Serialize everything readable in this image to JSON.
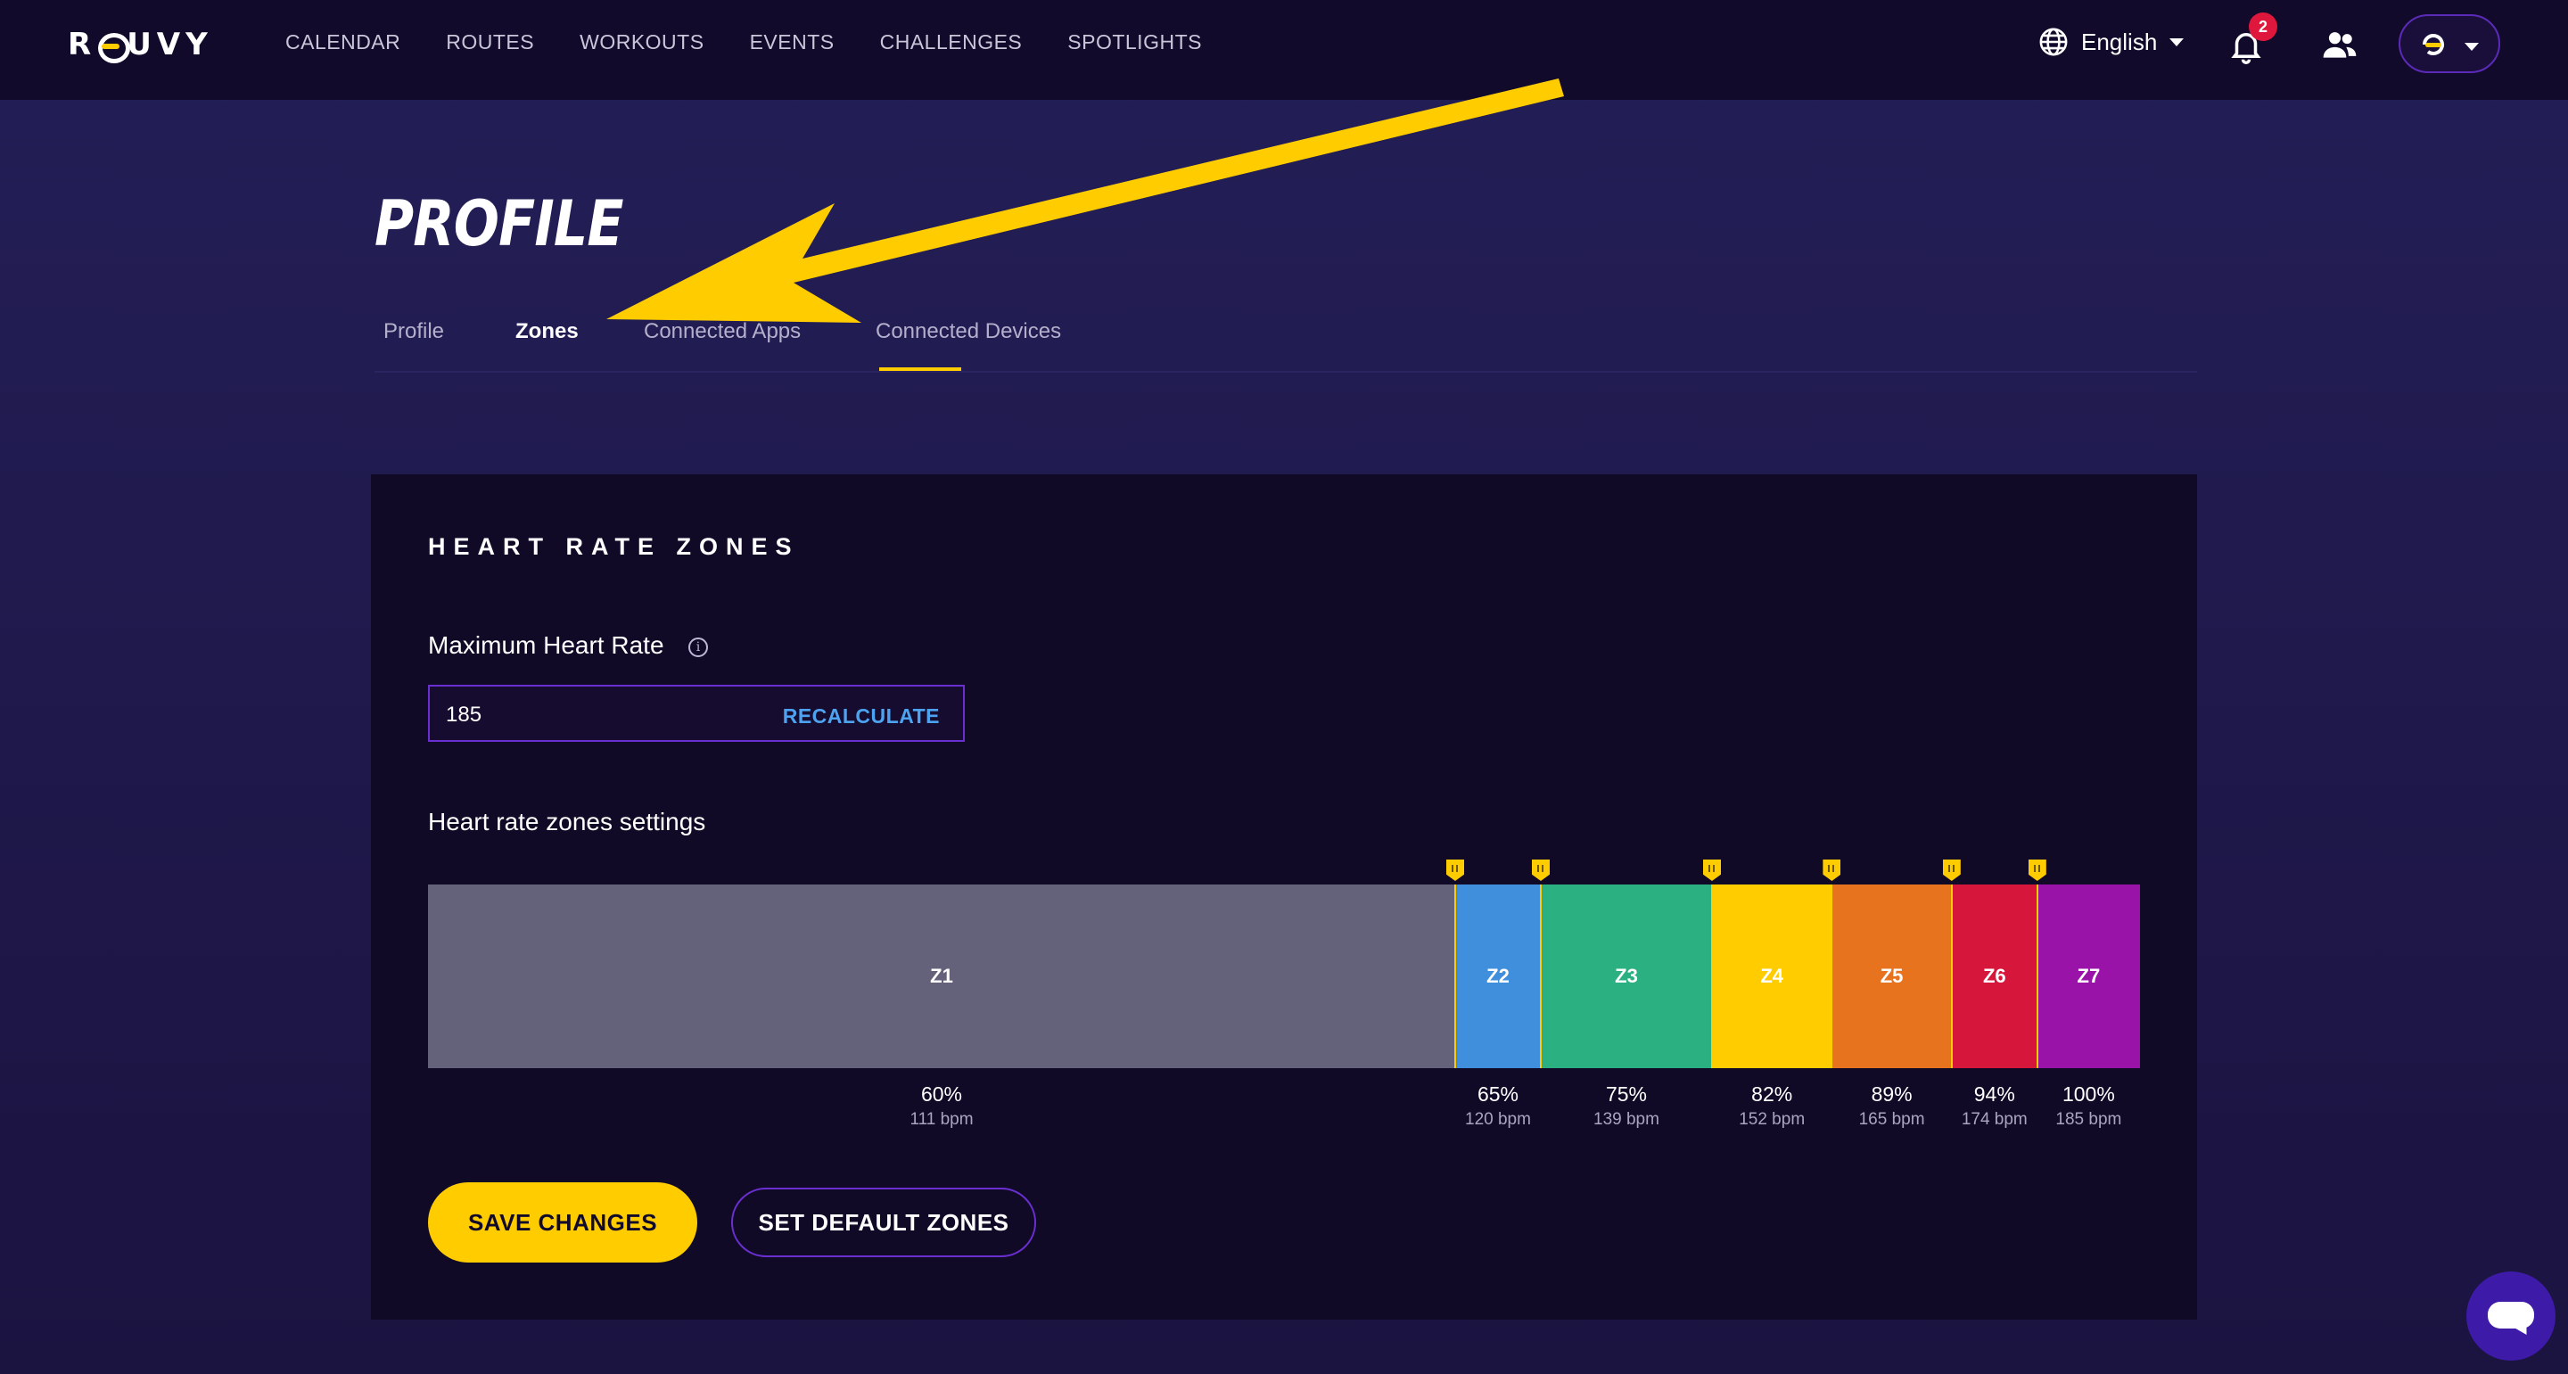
{
  "brand": "ROUVY",
  "nav": [
    "CALENDAR",
    "ROUTES",
    "WORKOUTS",
    "EVENTS",
    "CHALLENGES",
    "SPOTLIGHTS"
  ],
  "header": {
    "language": "English",
    "notification_count": "2"
  },
  "page": {
    "title": "PROFILE",
    "tabs": [
      "Profile",
      "Zones",
      "Connected Apps",
      "Connected Devices"
    ],
    "active_tab": "Zones"
  },
  "card": {
    "title": "HEART RATE ZONES",
    "max_hr_label": "Maximum Heart Rate",
    "info_glyph": "i",
    "max_hr_value": "185",
    "recalculate_label": "RECALCULATE",
    "zones_settings_label": "Heart rate zones settings"
  },
  "zones": [
    {
      "name": "Z1",
      "start_pct": 0,
      "end_pct": 60,
      "pct_label": "60%",
      "bpm_label": "111 bpm",
      "color": "#64627a"
    },
    {
      "name": "Z2",
      "start_pct": 60,
      "end_pct": 65,
      "pct_label": "65%",
      "bpm_label": "120 bpm",
      "color": "#3f8fdc"
    },
    {
      "name": "Z3",
      "start_pct": 65,
      "end_pct": 75,
      "pct_label": "75%",
      "bpm_label": "139 bpm",
      "color": "#2bb081"
    },
    {
      "name": "Z4",
      "start_pct": 75,
      "end_pct": 82,
      "pct_label": "82%",
      "bpm_label": "152 bpm",
      "color": "#ffcc00"
    },
    {
      "name": "Z5",
      "start_pct": 82,
      "end_pct": 89,
      "pct_label": "89%",
      "bpm_label": "165 bpm",
      "color": "#e8731f"
    },
    {
      "name": "Z6",
      "start_pct": 89,
      "end_pct": 94,
      "pct_label": "94%",
      "bpm_label": "174 bpm",
      "color": "#d6163a"
    },
    {
      "name": "Z7",
      "start_pct": 94,
      "end_pct": 100,
      "pct_label": "100%",
      "bpm_label": "185 bpm",
      "color": "#9a13a8"
    }
  ],
  "buttons": {
    "save": "SAVE CHANGES",
    "default_zones": "SET DEFAULT ZONES"
  },
  "colors": {
    "accent": "#ffcc00",
    "link": "#4da3f0",
    "outline": "#6a2fd0"
  },
  "icons": [
    "globe-icon",
    "bell-icon",
    "friends-icon",
    "chat-icon",
    "info-icon",
    "annotation-arrow"
  ]
}
